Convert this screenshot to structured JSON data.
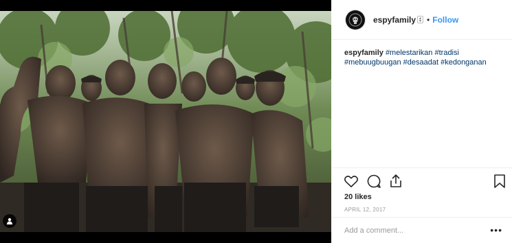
{
  "post": {
    "username": "espyfamily",
    "follow_label": "Follow",
    "separator": "•",
    "caption": {
      "author": "espyfamily",
      "hashtags": [
        "#melestarikan",
        "#tradisi",
        "#mebuugbuugan",
        "#desaadat",
        "#kedonganan"
      ]
    },
    "likes": "20 likes",
    "date": "APRIL 12, 2017",
    "comment_placeholder": "Add a comment...",
    "more_label": "•••"
  },
  "icons": {
    "like": "heart-icon",
    "comment": "speech-bubble-icon",
    "share": "share-icon",
    "save": "bookmark-icon",
    "tagged_users": "person-icon",
    "avatar": "skull-logo-icon"
  },
  "colors": {
    "link_blue": "#3897f0",
    "hashtag": "#003569",
    "muted": "#999999",
    "text": "#262626"
  }
}
